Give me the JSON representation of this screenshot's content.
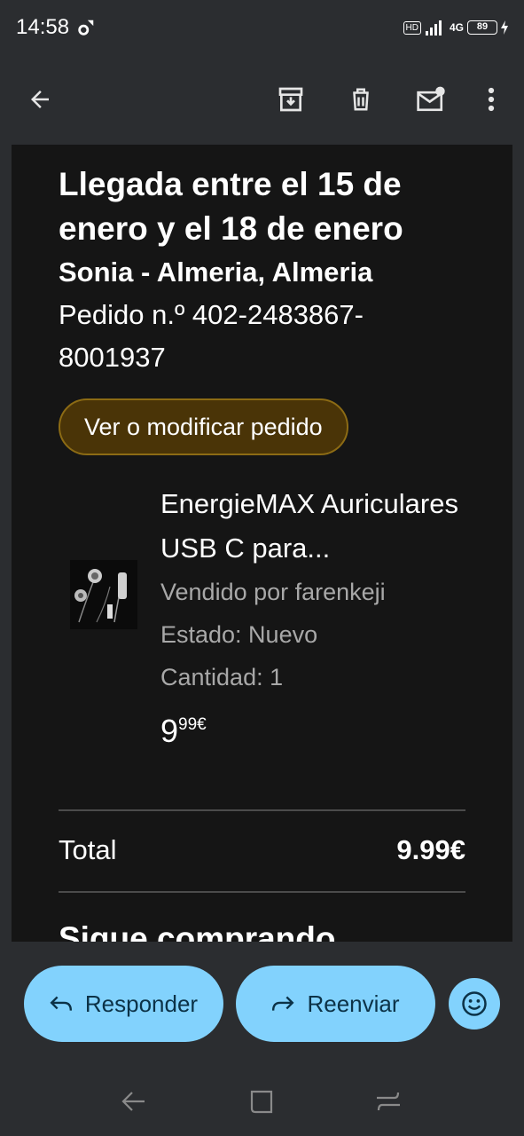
{
  "status_bar": {
    "time": "14:58",
    "network": "4G",
    "battery": "89",
    "hd": "HD"
  },
  "app_bar": {
    "icons": [
      "back-arrow-icon",
      "archive-icon",
      "delete-icon",
      "mark-unread-icon",
      "more-vert-icon"
    ]
  },
  "email": {
    "headline": "Llegada entre el 15 de enero y el 18 de enero",
    "recipient": "Sonia - Almeria, Almeria",
    "order_number": "Pedido n.º 402-2483867-8001937",
    "order_button": "Ver o modificar pedido",
    "product": {
      "name": "EnergieMAX Auriculares USB C para...",
      "seller": "Vendido por farenkeji",
      "condition": "Estado: Nuevo",
      "quantity": "Cantidad: 1",
      "price_whole": "9",
      "price_fraction": "99€"
    },
    "total_label": "Total",
    "total_value": "9.99€",
    "keep_shopping": "Sigue comprando"
  },
  "actions": {
    "reply": "Responder",
    "forward": "Reenviar"
  },
  "colors": {
    "accent_button": "#82d2fd",
    "order_button_bg": "#4a3407",
    "panel_bg": "#151515",
    "app_bg": "#2b2d30"
  }
}
